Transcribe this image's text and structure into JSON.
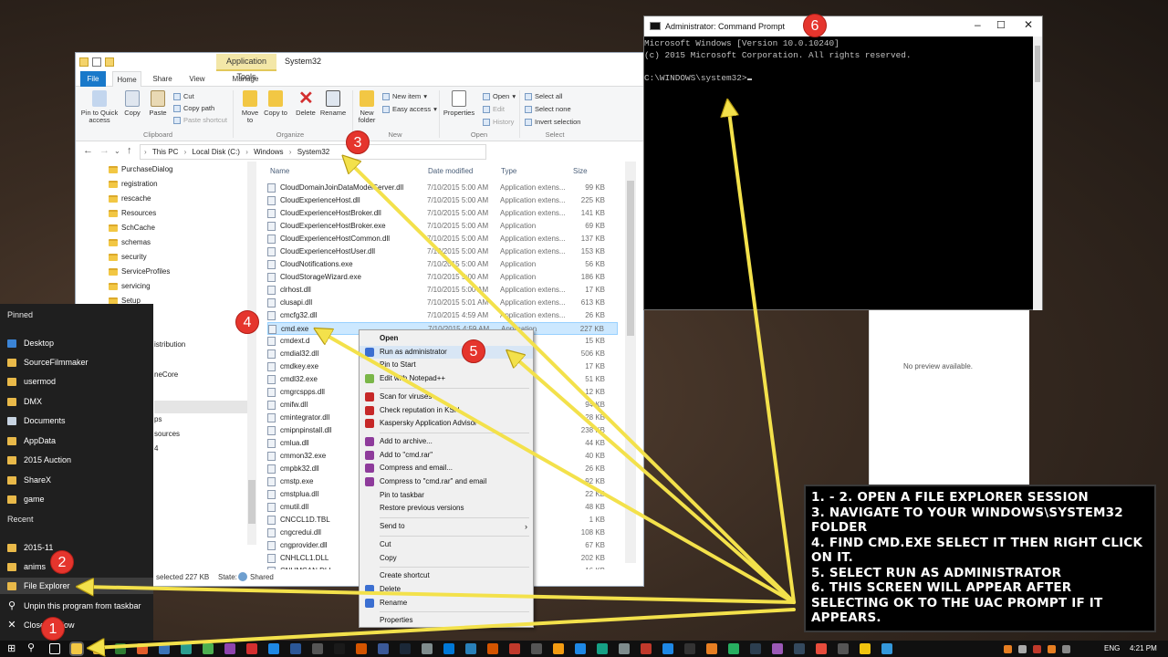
{
  "explorer": {
    "context_tab_group": "Application Tools",
    "window_title": "System32",
    "tabs": [
      "File",
      "Home",
      "Share",
      "View",
      "Manage"
    ],
    "ribbon": {
      "pin_to_quick_access": "Pin to Quick access",
      "copy": "Copy",
      "paste": "Paste",
      "cut": "Cut",
      "copy_path": "Copy path",
      "paste_shortcut": "Paste shortcut",
      "move_to": "Move to",
      "copy_to": "Copy to",
      "delete": "Delete",
      "rename": "Rename",
      "new_folder": "New folder",
      "new_item": "New item",
      "easy_access": "Easy access",
      "properties": "Properties",
      "open": "Open",
      "edit": "Edit",
      "history": "History",
      "select_all": "Select all",
      "select_none": "Select none",
      "invert_selection": "Invert selection",
      "groups": [
        "Clipboard",
        "Organize",
        "New",
        "Open",
        "Select"
      ]
    },
    "breadcrumb": [
      "This PC",
      "Local Disk (C:)",
      "Windows",
      "System32"
    ],
    "nav_items": [
      "PurchaseDialog",
      "registration",
      "rescache",
      "Resources",
      "SchCache",
      "schemas",
      "security",
      "ServiceProfiles",
      "servicing",
      "Setup"
    ],
    "nav_partial": [
      "istribution",
      "neCore",
      "ps",
      "sources",
      "4"
    ],
    "columns": {
      "name": "Name",
      "date": "Date modified",
      "type": "Type",
      "size": "Size"
    },
    "files": [
      {
        "name": "CloudDomainJoinDataModelServer.dll",
        "date": "7/10/2015 5:00 AM",
        "type": "Application extens...",
        "size": "99 KB"
      },
      {
        "name": "CloudExperienceHost.dll",
        "date": "7/10/2015 5:00 AM",
        "type": "Application extens...",
        "size": "225 KB"
      },
      {
        "name": "CloudExperienceHostBroker.dll",
        "date": "7/10/2015 5:00 AM",
        "type": "Application extens...",
        "size": "141 KB"
      },
      {
        "name": "CloudExperienceHostBroker.exe",
        "date": "7/10/2015 5:00 AM",
        "type": "Application",
        "size": "69 KB"
      },
      {
        "name": "CloudExperienceHostCommon.dll",
        "date": "7/10/2015 5:00 AM",
        "type": "Application extens...",
        "size": "137 KB"
      },
      {
        "name": "CloudExperienceHostUser.dll",
        "date": "7/10/2015 5:00 AM",
        "type": "Application extens...",
        "size": "153 KB"
      },
      {
        "name": "CloudNotifications.exe",
        "date": "7/10/2015 5:00 AM",
        "type": "Application",
        "size": "56 KB"
      },
      {
        "name": "CloudStorageWizard.exe",
        "date": "7/10/2015 5:00 AM",
        "type": "Application",
        "size": "186 KB"
      },
      {
        "name": "clrhost.dll",
        "date": "7/10/2015 5:00 AM",
        "type": "Application extens...",
        "size": "17 KB"
      },
      {
        "name": "clusapi.dll",
        "date": "7/10/2015 5:01 AM",
        "type": "Application extens...",
        "size": "613 KB"
      },
      {
        "name": "cmcfg32.dll",
        "date": "7/10/2015 4:59 AM",
        "type": "Application extens...",
        "size": "26 KB"
      },
      {
        "name": "cmd.exe",
        "date": "7/10/2015 4:59 AM",
        "type": "Application",
        "size": "227 KB"
      },
      {
        "name": "cmdext.d",
        "date": "",
        "type": "extens...",
        "size": "15 KB"
      },
      {
        "name": "cmdial32.dll",
        "date": "",
        "type": "extens...",
        "size": "506 KB"
      },
      {
        "name": "cmdkey.exe",
        "date": "",
        "type": "",
        "size": "17 KB"
      },
      {
        "name": "cmdl32.exe",
        "date": "",
        "type": "",
        "size": "51 KB"
      },
      {
        "name": "cmgrcspps.dll",
        "date": "",
        "type": "extens...",
        "size": "12 KB"
      },
      {
        "name": "cmifw.dll",
        "date": "",
        "type": "extens...",
        "size": "94 KB"
      },
      {
        "name": "cmintegrator.dll",
        "date": "",
        "type": "extens...",
        "size": "28 KB"
      },
      {
        "name": "cmipnpinstall.dll",
        "date": "",
        "type": "extens...",
        "size": "238 KB"
      },
      {
        "name": "cmlua.dll",
        "date": "",
        "type": "extens...",
        "size": "44 KB"
      },
      {
        "name": "cmmon32.exe",
        "date": "",
        "type": "",
        "size": "40 KB"
      },
      {
        "name": "cmpbk32.dll",
        "date": "",
        "type": "extens...",
        "size": "26 KB"
      },
      {
        "name": "cmstp.exe",
        "date": "",
        "type": "",
        "size": "92 KB"
      },
      {
        "name": "cmstplua.dll",
        "date": "",
        "type": "extens...",
        "size": "22 KB"
      },
      {
        "name": "cmutil.dll",
        "date": "",
        "type": "extens...",
        "size": "48 KB"
      },
      {
        "name": "CNCCL1D.TBL",
        "date": "",
        "type": "",
        "size": "1 KB"
      },
      {
        "name": "cngcredui.dll",
        "date": "",
        "type": "extens...",
        "size": "108 KB"
      },
      {
        "name": "cngprovider.dll",
        "date": "",
        "type": "extens...",
        "size": "67 KB"
      },
      {
        "name": "CNHLCL1.DLL",
        "date": "",
        "type": "extens...",
        "size": "202 KB"
      },
      {
        "name": "CNHMCAN.DLL",
        "date": "",
        "type": "extens...",
        "size": "16 KB"
      }
    ],
    "status_selected": "selected  227 KB",
    "status_state_label": "State:",
    "status_state_value": "Shared"
  },
  "preview_text": "No preview available.",
  "cmd": {
    "title": "Administrator: Command Prompt",
    "lines": [
      "Microsoft Windows [Version 10.0.10240]",
      "(c) 2015 Microsoft Corporation. All rights reserved.",
      "",
      "C:\\WINDOWS\\system32>"
    ]
  },
  "context_menu": [
    {
      "label": "Open",
      "bold": true
    },
    {
      "label": "Run as administrator",
      "hl": true
    },
    {
      "label": "Pin to Start"
    },
    {
      "label": "Edit with Notepad++"
    },
    {
      "sep": true
    },
    {
      "label": "Scan for viruses"
    },
    {
      "label": "Check reputation in KSN"
    },
    {
      "label": "Kaspersky Application Advisor"
    },
    {
      "sep": true
    },
    {
      "label": "Add to archive..."
    },
    {
      "label": "Add to \"cmd.rar\""
    },
    {
      "label": "Compress and email..."
    },
    {
      "label": "Compress to \"cmd.rar\" and email"
    },
    {
      "label": "Pin to taskbar"
    },
    {
      "label": "Restore previous versions"
    },
    {
      "sep": true
    },
    {
      "label": "Send to",
      "sub": true
    },
    {
      "sep": true
    },
    {
      "label": "Cut"
    },
    {
      "label": "Copy"
    },
    {
      "sep": true
    },
    {
      "label": "Create shortcut"
    },
    {
      "label": "Delete"
    },
    {
      "label": "Rename"
    },
    {
      "sep": true
    },
    {
      "label": "Properties"
    }
  ],
  "jumplist": {
    "pinned_heading": "Pinned",
    "pinned": [
      "Desktop",
      "SourceFilmmaker",
      "usermod",
      "DMX",
      "Documents",
      "AppData",
      "2015 Auction",
      "ShareX",
      "game"
    ],
    "recent_heading": "Recent",
    "recent": [
      "2015-11",
      "anims"
    ],
    "actions": [
      "File Explorer",
      "Unpin this program from taskbar",
      "Close window"
    ]
  },
  "taskbar": {
    "lang": "ENG",
    "time": "4:21 PM"
  },
  "instructions": [
    "1. - 2. Open a file explorer session",
    "3. Navigate to your windows\\system32",
    "folder",
    "4. Find cmd.exe select it then right click",
    "on it.",
    "5. Select run as administrator",
    "6. This screen will appear after",
    "selecting ok to the UAC prompt if it",
    "appears."
  ],
  "badges": [
    "1",
    "2",
    "3",
    "4",
    "5",
    "6"
  ],
  "colors": {
    "badge": "#e5352d",
    "arrow": "#f3e14b",
    "accent": "#1979ca"
  }
}
